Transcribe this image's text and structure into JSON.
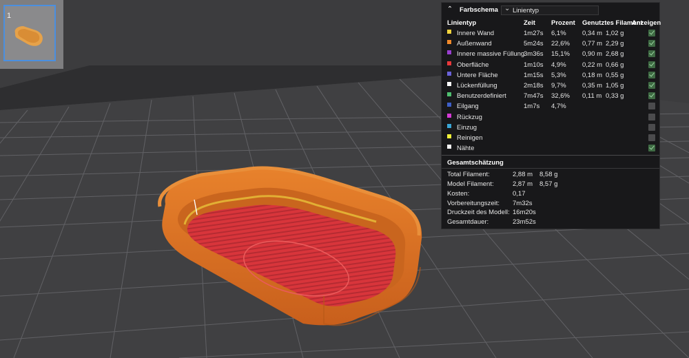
{
  "plate_thumbnail": {
    "number": "1"
  },
  "legend": {
    "scheme_label": "Farbschema",
    "scheme_value": "Linientyp",
    "columns": {
      "type": "Linientyp",
      "time": "Zeit",
      "percent": "Prozent",
      "filament": "Genutztes Filament",
      "show": "Anzeigen"
    },
    "rows": [
      {
        "name": "Innere Wand",
        "time": "1m27s",
        "percent": "6,1%",
        "length": "0,34 m",
        "weight": "1,02 g",
        "color": "#f2d33d",
        "checked": true
      },
      {
        "name": "Außenwand",
        "time": "5m24s",
        "percent": "22,6%",
        "length": "0,77 m",
        "weight": "2,29 g",
        "color": "#f08a2a",
        "checked": true
      },
      {
        "name": "Innere massive Füllung",
        "time": "3m36s",
        "percent": "15,1%",
        "length": "0,90 m",
        "weight": "2,68 g",
        "color": "#9a3fd0",
        "checked": true
      },
      {
        "name": "Oberfläche",
        "time": "1m10s",
        "percent": "4,9%",
        "length": "0,22 m",
        "weight": "0,66 g",
        "color": "#e8383b",
        "checked": true
      },
      {
        "name": "Untere Fläche",
        "time": "1m15s",
        "percent": "5,3%",
        "length": "0,18 m",
        "weight": "0,55 g",
        "color": "#6a62d8",
        "checked": true
      },
      {
        "name": "Lückenfüllung",
        "time": "2m18s",
        "percent": "9,7%",
        "length": "0,35 m",
        "weight": "1,05 g",
        "color": "#ffffff",
        "checked": true
      },
      {
        "name": "Benutzerdefiniert",
        "time": "7m47s",
        "percent": "32,6%",
        "length": "0,11 m",
        "weight": "0,33 g",
        "color": "#4fbf6f",
        "checked": true
      },
      {
        "name": "Eilgang",
        "time": "1m7s",
        "percent": "4,7%",
        "length": "",
        "weight": "",
        "color": "#3e5fc8",
        "checked": false
      },
      {
        "name": "Rückzug",
        "time": "",
        "percent": "",
        "length": "",
        "weight": "",
        "color": "#d63ad6",
        "checked": false
      },
      {
        "name": "Einzug",
        "time": "",
        "percent": "",
        "length": "",
        "weight": "",
        "color": "#3aa6d6",
        "checked": false
      },
      {
        "name": "Reinigen",
        "time": "",
        "percent": "",
        "length": "",
        "weight": "",
        "color": "#f2f23a",
        "checked": false
      },
      {
        "name": "Nähte",
        "time": "",
        "percent": "",
        "length": "",
        "weight": "",
        "color": "#f4f4f4",
        "checked": true
      }
    ],
    "summary_title": "Gesamtschätzung",
    "summary": [
      {
        "label": "Total Filament:",
        "value1": "2,88 m",
        "value2": "8,58 g"
      },
      {
        "label": "Model Filament:",
        "value1": "2,87 m",
        "value2": "8,57 g"
      },
      {
        "label": "Kosten:",
        "value1": "0,17",
        "value2": ""
      },
      {
        "label": "Vorbereitungszeit:",
        "value1": "7m32s",
        "value2": ""
      },
      {
        "label": "Druckzeit des Modell:",
        "value1": "16m20s",
        "value2": ""
      },
      {
        "label": "Gesamtdauer:",
        "value1": "23m52s",
        "value2": ""
      }
    ]
  },
  "colors": {
    "background": "#3c3c3e",
    "panel": "#18181a",
    "model_wall": "#e07a28",
    "model_floor": "#d83a3a",
    "selection": "#4a8fe0"
  }
}
